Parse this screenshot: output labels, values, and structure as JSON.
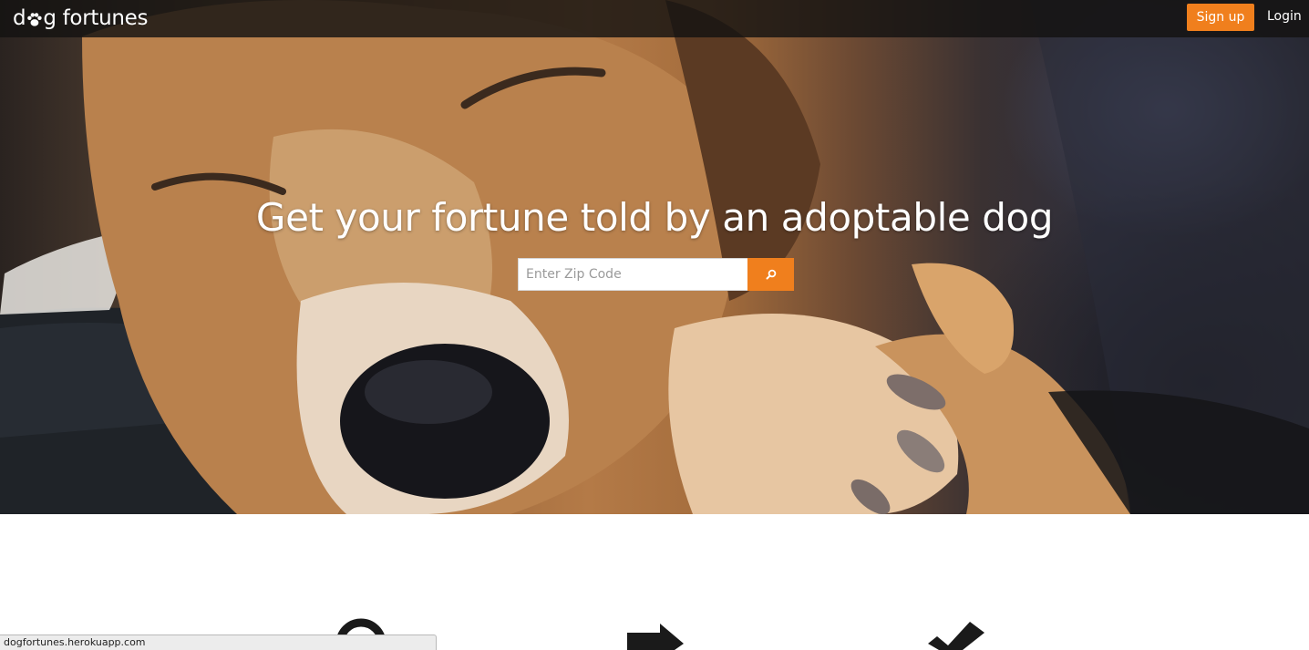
{
  "header": {
    "logo_prefix": "d",
    "logo_suffix": "g fortunes",
    "signup_label": "Sign up",
    "login_label": "Login"
  },
  "hero": {
    "headline": "Get your fortune told by an adoptable dog",
    "search": {
      "placeholder": "Enter Zip Code",
      "value": "",
      "button_icon": "search-icon"
    }
  },
  "features": {
    "icons": [
      "search-icon",
      "arrow-right-icon",
      "checkmark-icon"
    ]
  },
  "status_bar": {
    "url": "dogfortunes.herokuapp.com"
  },
  "colors": {
    "accent": "#f07f1d",
    "topbar": "#141211",
    "text_light": "#ffffff"
  }
}
